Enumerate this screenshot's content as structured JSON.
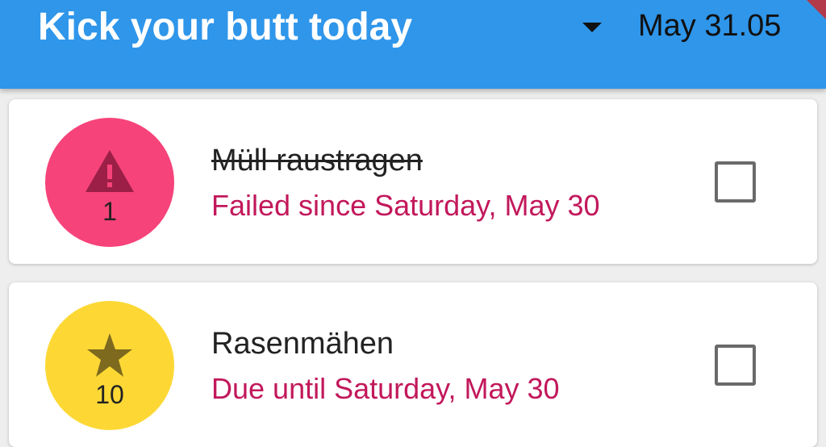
{
  "appbar": {
    "title": "Kick your butt today",
    "date": "May 31.05",
    "background_color": "#2f96ea"
  },
  "tasks": [
    {
      "title": "Müll raustragen",
      "status_text": "Failed since Saturday, May 30",
      "count": "1",
      "icon": "warning-icon",
      "avatar_color": "#f6437a",
      "status_color": "#c2185b",
      "completed_strike": true,
      "checked": false
    },
    {
      "title": "Rasenmähen",
      "status_text": "Due until Saturday, May 30",
      "count": "10",
      "icon": "star-icon",
      "avatar_color": "#fdd835",
      "status_color": "#c2185b",
      "completed_strike": false,
      "checked": false
    }
  ]
}
